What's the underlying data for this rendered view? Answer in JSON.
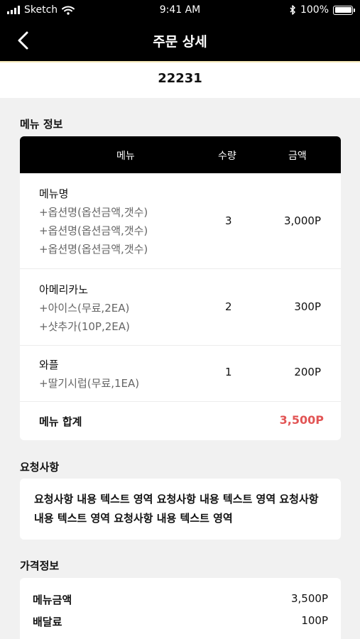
{
  "status": {
    "carrier": "Sketch",
    "time": "9:41 AM",
    "battery": "100%",
    "battery_level": 1.0
  },
  "header": {
    "title": "주문 상세"
  },
  "order": {
    "number": "22231"
  },
  "menu_info": {
    "title": "메뉴 정보",
    "columns": {
      "menu": "메뉴",
      "qty": "수량",
      "amount": "금액"
    },
    "items": [
      {
        "name": "메뉴명",
        "options": [
          "+옵션명(옵션금액,갯수)",
          "+옵션명(옵션금액,갯수)",
          "+옵션명(옵션금액,갯수)"
        ],
        "qty": "3",
        "amount": "3,000P"
      },
      {
        "name": "아메리카노",
        "options": [
          "+아이스(무료,2EA)",
          "+샷추가(10P,2EA)"
        ],
        "qty": "2",
        "amount": "300P"
      },
      {
        "name": "와플",
        "options": [
          "+딸기시럽(무료,1EA)"
        ],
        "qty": "1",
        "amount": "200P"
      }
    ],
    "total_label": "메뉴 합계",
    "total_value": "3,500P"
  },
  "request": {
    "title": "요청사항",
    "text": "요청사항 내용 텍스트 영역 요청사항 내용 텍스트 영역 요청사항 내용 텍스트 영역 요청사항 내용 텍스트 영역"
  },
  "price_info": {
    "title": "가격정보",
    "rows": [
      {
        "label": "메뉴금액",
        "value": "3,500P"
      },
      {
        "label": "배달료",
        "value": "100P"
      }
    ]
  },
  "colors": {
    "accent_total": "#e25555",
    "header_bg": "#000000"
  }
}
